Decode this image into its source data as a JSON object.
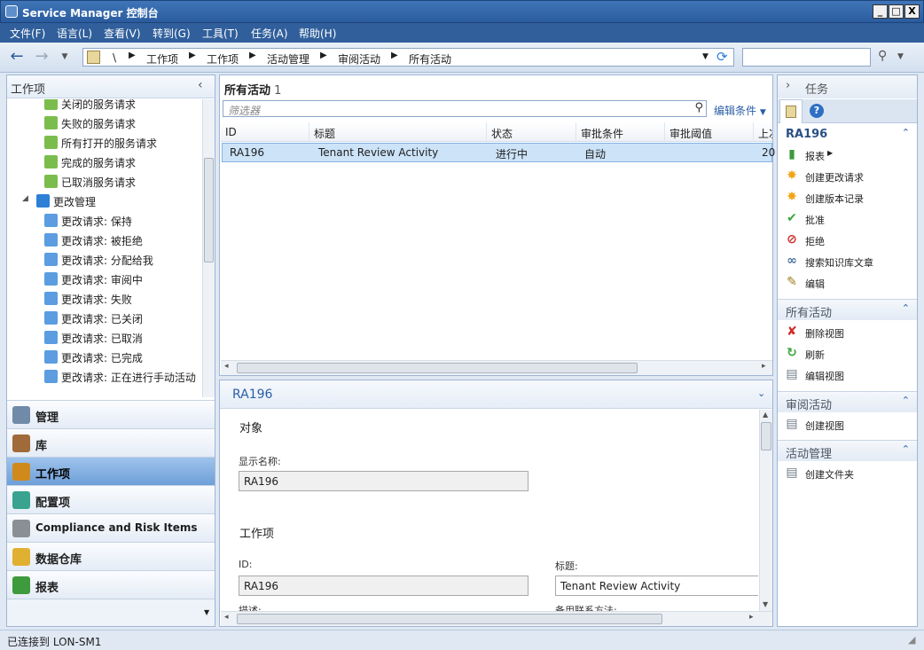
{
  "window": {
    "title": "Service Manager 控制台",
    "min": "_",
    "max": "□",
    "close": "X"
  },
  "menu": [
    "文件(F)",
    "语言(L)",
    "查看(V)",
    "转到(G)",
    "工具(T)",
    "任务(A)",
    "帮助(H)"
  ],
  "address": {
    "root": "\\",
    "crumbs": [
      "工作项",
      "工作项",
      "活动管理",
      "审阅活动",
      "所有活动"
    ],
    "search_placeholder": ""
  },
  "left": {
    "header": "工作项",
    "tree": [
      {
        "label": "关闭的服务请求",
        "color": "#7bbd4d"
      },
      {
        "label": "失败的服务请求",
        "color": "#7bbd4d"
      },
      {
        "label": "所有打开的服务请求",
        "color": "#7bbd4d"
      },
      {
        "label": "完成的服务请求",
        "color": "#7bbd4d"
      },
      {
        "label": "已取消服务请求",
        "color": "#7bbd4d"
      },
      {
        "label": "更改管理",
        "color": "#2e7fd6"
      },
      {
        "label": "更改请求: 保持",
        "color": "#5b9de0"
      },
      {
        "label": "更改请求: 被拒绝",
        "color": "#5b9de0"
      },
      {
        "label": "更改请求: 分配给我",
        "color": "#5b9de0"
      },
      {
        "label": "更改请求: 审阅中",
        "color": "#5b9de0"
      },
      {
        "label": "更改请求: 失败",
        "color": "#5b9de0"
      },
      {
        "label": "更改请求: 已关闭",
        "color": "#5b9de0"
      },
      {
        "label": "更改请求: 已取消",
        "color": "#5b9de0"
      },
      {
        "label": "更改请求: 已完成",
        "color": "#5b9de0"
      },
      {
        "label": "更改请求: 正在进行手动活动",
        "color": "#5b9de0"
      }
    ],
    "nav": [
      {
        "label": "管理",
        "color": "#6f8ba8"
      },
      {
        "label": "库",
        "color": "#a06a3a"
      },
      {
        "label": "工作项",
        "color": "#d08a1c"
      },
      {
        "label": "配置项",
        "color": "#3aa38f"
      },
      {
        "label": "Compliance and Risk Items",
        "color": "#8a8f96"
      },
      {
        "label": "数据仓库",
        "color": "#e0b030"
      },
      {
        "label": "报表",
        "color": "#3d9a3d"
      }
    ]
  },
  "list": {
    "title": "所有活动",
    "count": "1",
    "filter_placeholder": "筛选器",
    "edit_criteria": "编辑条件",
    "columns": [
      "ID",
      "标题",
      "状态",
      "审批条件",
      "审批阈值",
      "上次"
    ],
    "rows": [
      {
        "id": "RA196",
        "title": "Tenant Review Activity",
        "status": "进行中",
        "condition": "自动",
        "threshold": "",
        "last": "20"
      }
    ]
  },
  "detail": {
    "header": "RA196",
    "section_object": "对象",
    "display_name_label": "显示名称:",
    "display_name_value": "RA196",
    "section_workitem": "工作项",
    "id_label": "ID:",
    "id_value": "RA196",
    "title_label": "标题:",
    "title_value": "Tenant Review Activity",
    "desc_label": "描述:",
    "alt_contact_label": "备用联系方法:"
  },
  "tasks": {
    "header": "任务",
    "sections": [
      {
        "title": "RA196",
        "items": [
          {
            "label": "报表",
            "icon": "report-icon",
            "glyph": "▮",
            "color": "#3d9a3d"
          },
          {
            "label": "创建更改请求",
            "icon": "sparkle-icon",
            "glyph": "✸",
            "color": "#f2a51a"
          },
          {
            "label": "创建版本记录",
            "icon": "sparkle-icon",
            "glyph": "✸",
            "color": "#f2a51a"
          },
          {
            "label": "批准",
            "icon": "check-icon",
            "glyph": "✔",
            "color": "#3ba53b"
          },
          {
            "label": "拒绝",
            "icon": "deny-icon",
            "glyph": "⊘",
            "color": "#d12a2a"
          },
          {
            "label": "搜索知识库文章",
            "icon": "link-icon",
            "glyph": "∞",
            "color": "#4b6f9c"
          },
          {
            "label": "编辑",
            "icon": "pencil-icon",
            "glyph": "✎",
            "color": "#a0791c"
          }
        ]
      },
      {
        "title": "所有活动",
        "items": [
          {
            "label": "删除视图",
            "icon": "delete-icon",
            "glyph": "✘",
            "color": "#d12a2a"
          },
          {
            "label": "刷新",
            "icon": "refresh-icon",
            "glyph": "↻",
            "color": "#3ba53b"
          },
          {
            "label": "编辑视图",
            "icon": "view-icon",
            "glyph": "▤",
            "color": "#707a86"
          }
        ]
      },
      {
        "title": "审阅活动",
        "items": [
          {
            "label": "创建视图",
            "icon": "view-icon",
            "glyph": "▤",
            "color": "#707a86"
          }
        ]
      },
      {
        "title": "活动管理",
        "items": [
          {
            "label": "创建文件夹",
            "icon": "folder-icon",
            "glyph": "▤",
            "color": "#707a86"
          }
        ]
      }
    ]
  },
  "status": {
    "text": "已连接到 LON-SM1"
  }
}
